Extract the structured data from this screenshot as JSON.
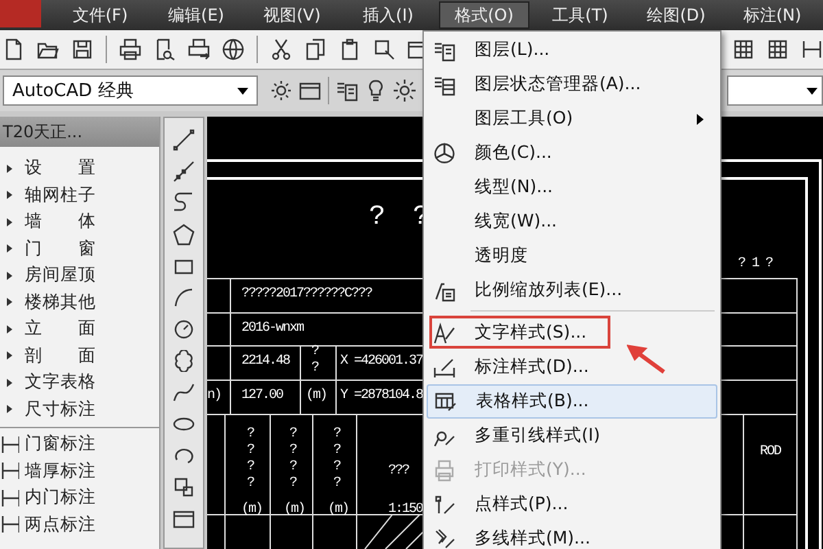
{
  "menubar": [
    {
      "label": "文件(F)",
      "selected": false
    },
    {
      "label": "编辑(E)",
      "selected": false
    },
    {
      "label": "视图(V)",
      "selected": false
    },
    {
      "label": "插入(I)",
      "selected": false
    },
    {
      "label": "格式(O)",
      "selected": true
    },
    {
      "label": "工具(T)",
      "selected": false
    },
    {
      "label": "绘图(D)",
      "selected": false
    },
    {
      "label": "标注(N)",
      "selected": false
    }
  ],
  "workspace": {
    "value": "AutoCAD 经典"
  },
  "tool_palette": {
    "title": "T20天正...",
    "items": [
      {
        "label": "设 置",
        "kind": "category"
      },
      {
        "label": "轴网柱子",
        "kind": "category"
      },
      {
        "label": "墙 体",
        "kind": "category"
      },
      {
        "label": "门 窗",
        "kind": "category"
      },
      {
        "label": "房间屋顶",
        "kind": "category"
      },
      {
        "label": "楼梯其他",
        "kind": "category"
      },
      {
        "label": "立 面",
        "kind": "category"
      },
      {
        "label": "剖 面",
        "kind": "category"
      },
      {
        "label": "文字表格",
        "kind": "category"
      },
      {
        "label": "尺寸标注",
        "kind": "category"
      },
      {
        "label": "门窗标注",
        "kind": "command"
      },
      {
        "label": "墙厚标注",
        "kind": "command"
      },
      {
        "label": "内门标注",
        "kind": "command"
      },
      {
        "label": "两点标注",
        "kind": "command"
      }
    ]
  },
  "drawing": {
    "labels": [
      "? ?",
      "? 1 ?",
      "?????2017??????C???",
      "2016-wnxm",
      "2214.48",
      "X =426001.37",
      "n)",
      "127.00",
      "(m)",
      "Y =2878104.8",
      "??",
      "????",
      "????",
      "????",
      "(m)",
      "(m)",
      "(m)",
      "???",
      "1:150",
      "ROD"
    ]
  },
  "format_menu": {
    "groups": [
      [
        {
          "label": "图层(L)...",
          "submenu": false,
          "disabled": false,
          "highlighted": false,
          "annotated": false
        },
        {
          "label": "图层状态管理器(A)...",
          "submenu": false,
          "disabled": false,
          "highlighted": false,
          "annotated": false
        },
        {
          "label": "图层工具(O)",
          "submenu": true,
          "disabled": false,
          "highlighted": false,
          "annotated": false
        },
        {
          "label": "颜色(C)...",
          "submenu": false,
          "disabled": false,
          "highlighted": false,
          "annotated": false
        },
        {
          "label": "线型(N)...",
          "submenu": false,
          "disabled": false,
          "highlighted": false,
          "annotated": false
        },
        {
          "label": "线宽(W)...",
          "submenu": false,
          "disabled": false,
          "highlighted": false,
          "annotated": false
        },
        {
          "label": "透明度",
          "submenu": false,
          "disabled": false,
          "highlighted": false,
          "annotated": false
        },
        {
          "label": "比例缩放列表(E)...",
          "submenu": false,
          "disabled": false,
          "highlighted": false,
          "annotated": false
        }
      ],
      [
        {
          "label": "文字样式(S)...",
          "submenu": false,
          "disabled": false,
          "highlighted": false,
          "annotated": true
        },
        {
          "label": "标注样式(D)...",
          "submenu": false,
          "disabled": false,
          "highlighted": false,
          "annotated": false
        },
        {
          "label": "表格样式(B)...",
          "submenu": false,
          "disabled": false,
          "highlighted": true,
          "annotated": false
        },
        {
          "label": "多重引线样式(I)",
          "submenu": false,
          "disabled": false,
          "highlighted": false,
          "annotated": false
        },
        {
          "label": "打印样式(Y)...",
          "submenu": false,
          "disabled": true,
          "highlighted": false,
          "annotated": false
        },
        {
          "label": "点样式(P)...",
          "submenu": false,
          "disabled": false,
          "highlighted": false,
          "annotated": false
        },
        {
          "label": "多线样式(M)...",
          "submenu": false,
          "disabled": false,
          "highlighted": false,
          "annotated": false
        }
      ]
    ]
  }
}
